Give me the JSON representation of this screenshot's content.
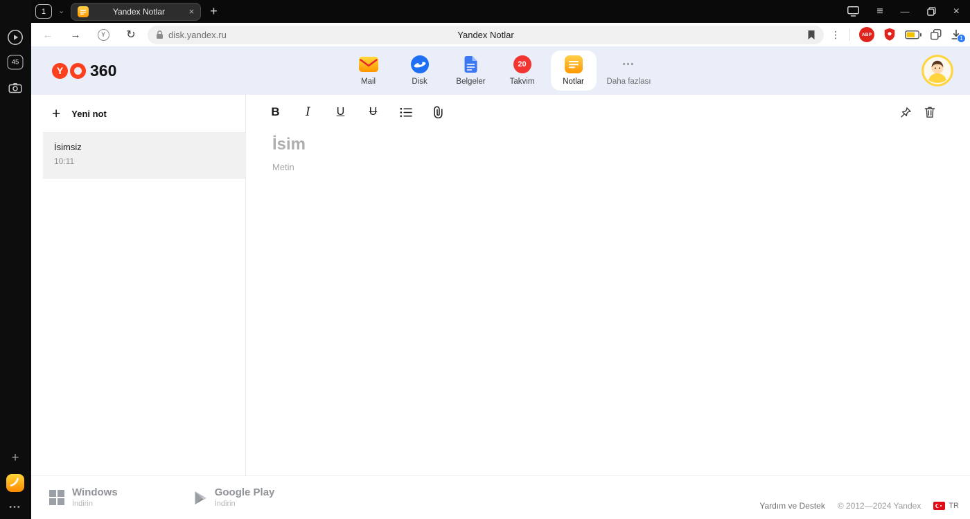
{
  "glyphs": {
    "plus": "+",
    "chevron_down": "⌄",
    "back_arrow": "←",
    "forward_arrow": "→",
    "reload": "↻",
    "kebab": "⋮",
    "menu": "≡",
    "minimize": "—",
    "close": "×",
    "protect_letter": "Y",
    "ellipsis": "•••"
  },
  "browser": {
    "sidebar": {
      "tab_counter": "45"
    },
    "tabstrip": {
      "group_label": "1",
      "tab_title": "Yandex Notlar"
    },
    "address_bar": {
      "url": "disk.yandex.ru",
      "page_title": "Yandex Notlar"
    },
    "extensions": {
      "abp_label": "ABP",
      "download_badge": "1"
    }
  },
  "header": {
    "logo_y": "Y",
    "logo_text": "360",
    "nav": [
      {
        "label": "Mail"
      },
      {
        "label": "Disk"
      },
      {
        "label": "Belgeler"
      },
      {
        "label": "Takvim",
        "badge": "20"
      },
      {
        "label": "Notlar"
      },
      {
        "label": "Daha fazlası"
      }
    ]
  },
  "notes": {
    "new_note_label": "Yeni not",
    "items": [
      {
        "title": "İsimsiz",
        "time": "10:11"
      }
    ]
  },
  "editor": {
    "toolbar": {
      "bold": "B",
      "italic": "I",
      "underline": "U",
      "strikethrough": "U"
    },
    "title_placeholder": "İsim",
    "body_placeholder": "Metin"
  },
  "footer": {
    "downloads": [
      {
        "name": "Windows",
        "action": "İndirin"
      },
      {
        "name": "Google Play",
        "action": "İndirin"
      }
    ],
    "help": "Yardım ve Destek",
    "copyright": "© 2012—2024 Yandex",
    "language": "TR"
  },
  "colors": {
    "accent_red": "#fc3f1d",
    "header_bg": "#e9eef9",
    "badge_blue": "#2f7cf6",
    "dark_chrome": "#0a0a0a"
  }
}
